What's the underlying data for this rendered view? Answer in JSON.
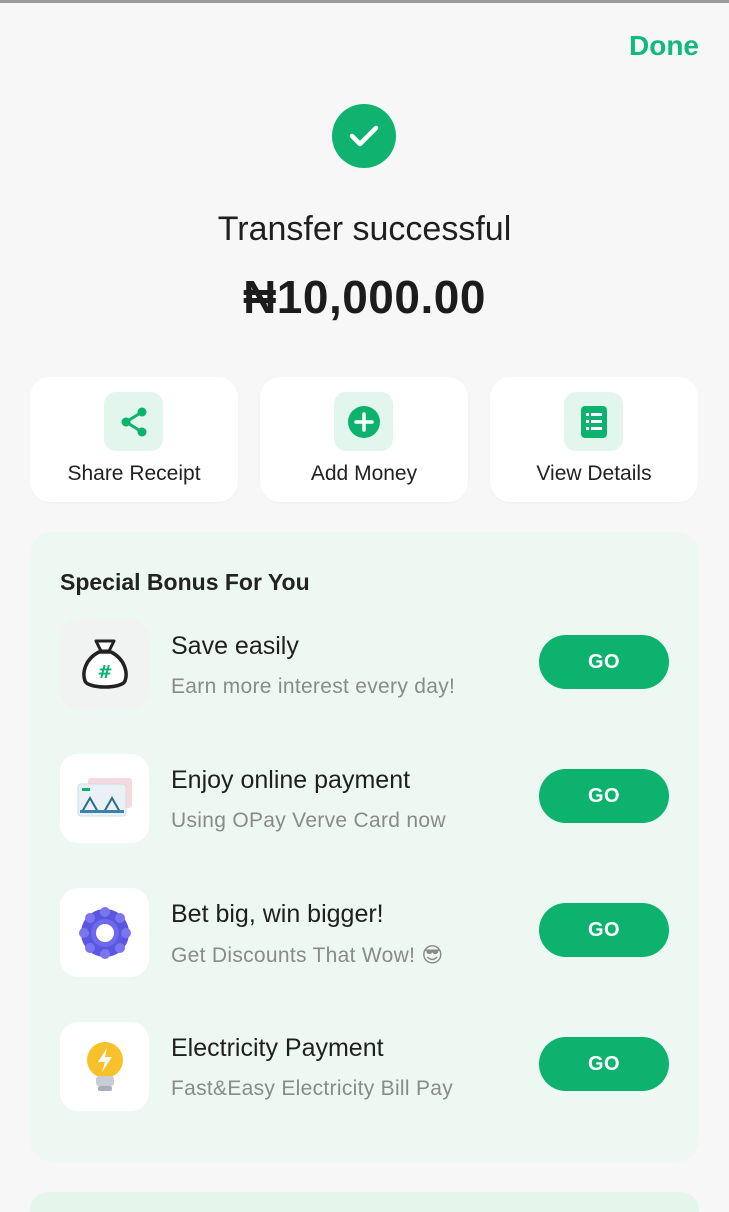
{
  "header": {
    "done_label": "Done"
  },
  "result": {
    "title": "Transfer successful",
    "amount": "₦10,000.00"
  },
  "actions": [
    {
      "label": "Share Receipt",
      "icon": "share-icon"
    },
    {
      "label": "Add Money",
      "icon": "add-circle-icon"
    },
    {
      "label": "View Details",
      "icon": "document-list-icon"
    }
  ],
  "bonus": {
    "title": "Special Bonus For You",
    "items": [
      {
        "title": "Save easily",
        "subtitle": "Earn more interest every day!",
        "button": "GO",
        "icon": "money-bag-icon"
      },
      {
        "title": "Enjoy online payment",
        "subtitle": "Using OPay Verve Card now",
        "button": "GO",
        "icon": "verve-card-icon"
      },
      {
        "title": "Bet big, win bigger!",
        "subtitle": "Get Discounts That Wow! 😎",
        "button": "GO",
        "icon": "betting-chip-icon"
      },
      {
        "title": "Electricity Payment",
        "subtitle": "Fast&Easy Electricity Bill Pay",
        "button": "GO",
        "icon": "light-bulb-icon"
      }
    ]
  },
  "colors": {
    "accent": "#0cb26d",
    "done": "#10b981",
    "bonus_bg": "#eef8f2"
  }
}
